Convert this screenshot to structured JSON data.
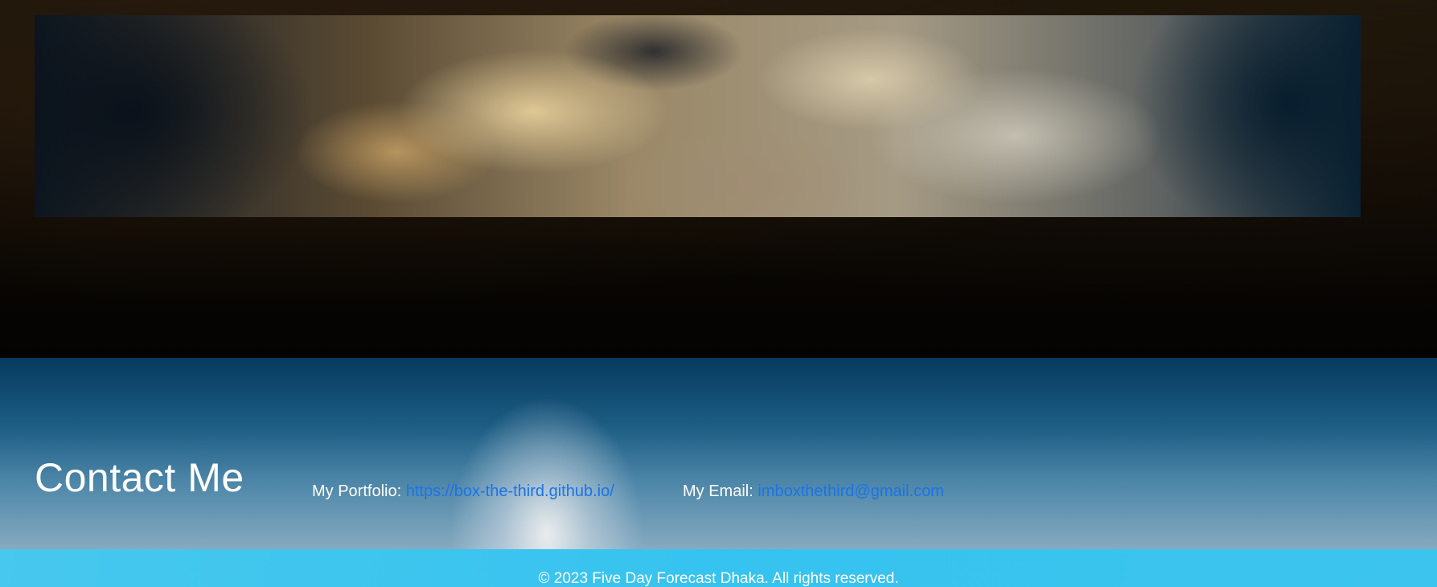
{
  "contact": {
    "title": "Contact Me",
    "portfolio_label": "My Portfolio:",
    "portfolio_link": "https://box-the-third.github.io/",
    "email_label": "My Email:",
    "email_link": "imboxthethird@gmail.com"
  },
  "footer": {
    "copyright": "© 2023 Five Day Forecast Dhaka. All rights reserved."
  },
  "colors": {
    "link": "#1a73e8",
    "footer_bg": "#36c3ef",
    "contact_bg_top": "#073a5e"
  }
}
